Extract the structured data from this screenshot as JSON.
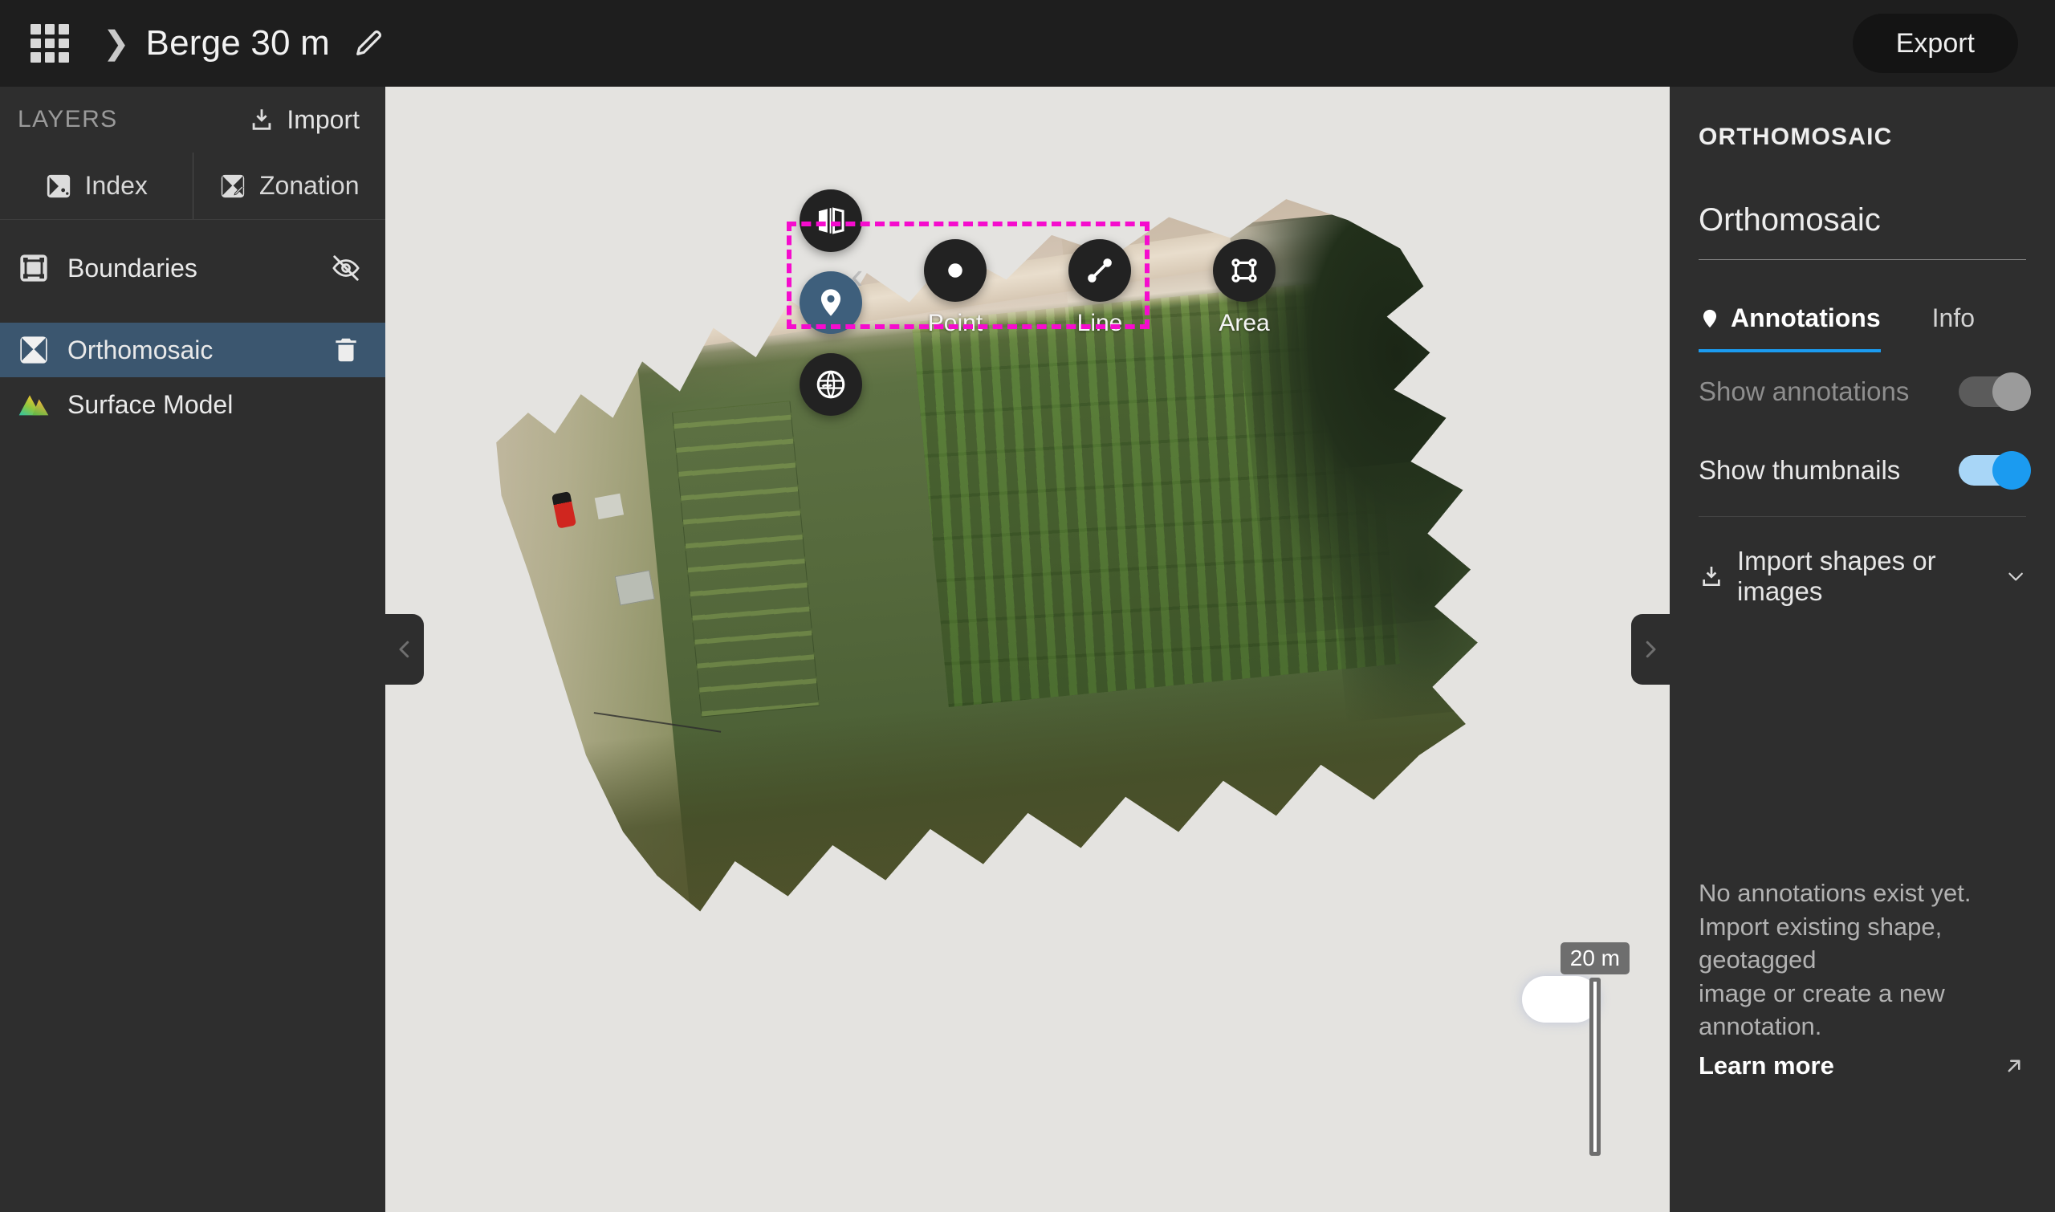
{
  "topbar": {
    "apps_icon": "grid-apps-icon",
    "breadcrumb_separator": "❯",
    "project_title": "Berge 30 m",
    "edit_icon": "pencil-icon",
    "export_label": "Export"
  },
  "sidebar": {
    "section_label": "LAYERS",
    "import_label": "Import",
    "import_icon": "import-tray-icon",
    "tabs": [
      {
        "label": "Index",
        "icon": "index-square-icon"
      },
      {
        "label": "Zonation",
        "icon": "zonation-pencil-icon"
      }
    ],
    "layers": [
      {
        "label": "Boundaries",
        "icon": "boundary-square-icon",
        "action_icon": "eye-off-icon",
        "selected": false
      },
      {
        "label": "Orthomosaic",
        "icon": "orthomosaic-x-icon",
        "action_icon": "trash-icon",
        "selected": true
      },
      {
        "label": "Surface Model",
        "icon": "surface-model-mountain-icon",
        "action_icon": "",
        "selected": false
      }
    ]
  },
  "map": {
    "tools": {
      "compare_icon": "split-compare-icon",
      "pin_icon": "map-pin-icon",
      "globe_icon": "globe-3d-icon",
      "chevron_right": "›",
      "chevron_left": "‹",
      "shapes": [
        {
          "label": "Point",
          "icon": "point-dot-icon"
        },
        {
          "label": "Line",
          "icon": "line-segment-icon"
        },
        {
          "label": "Area",
          "icon": "area-polygon-icon"
        }
      ],
      "highlight_color": "#f50ccd",
      "active_tool_color": "#3e5f7c"
    },
    "collapse_left_icon": "chevron-left-icon",
    "collapse_right_icon": "chevron-right-icon",
    "scale_label": "20 m",
    "background_color": "#e4e3e0"
  },
  "right_panel": {
    "kicker": "ORTHOMOSAIC",
    "name": "Orthomosaic",
    "tabs": [
      {
        "label": "Annotations",
        "icon": "map-pin-icon",
        "active": true
      },
      {
        "label": "Info",
        "icon": "",
        "active": false
      }
    ],
    "accent_color": "#1b9bf0",
    "toggles": [
      {
        "label": "Show annotations",
        "state": "off"
      },
      {
        "label": "Show thumbnails",
        "state": "on"
      }
    ],
    "import_shapes": {
      "label": "Import shapes or images",
      "icon": "import-tray-icon",
      "chevron": "chevron-down-icon"
    },
    "empty_state": {
      "line1": "No annotations exist yet.",
      "line2": "Import existing shape, geotagged",
      "line3": "image or create a new annotation.",
      "learn_more": "Learn more",
      "learn_more_icon": "external-link-arrow-icon"
    }
  }
}
